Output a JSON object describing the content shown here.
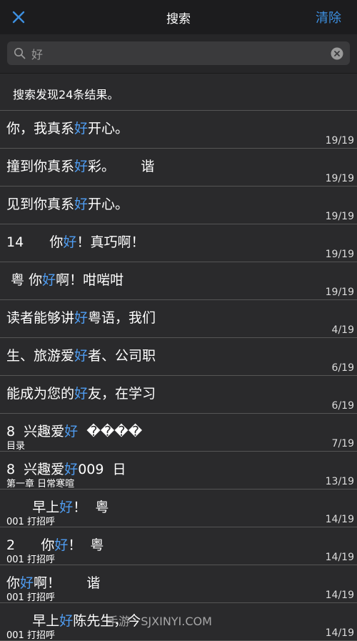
{
  "nav": {
    "title": "搜索",
    "clear_label": "清除",
    "close_icon": "close-icon"
  },
  "search": {
    "value": "好",
    "placeholder": ""
  },
  "summary": "搜索发现24条结果。",
  "results": [
    {
      "pre": "你，我真系",
      "hl": "好",
      "post": "开心。",
      "sub": "",
      "page": "19/19"
    },
    {
      "pre": "撞到你真系",
      "hl": "好",
      "post": "彩。      谐",
      "sub": "",
      "page": "19/19"
    },
    {
      "pre": "见到你真系",
      "hl": "好",
      "post": "开心。",
      "sub": "",
      "page": "19/19"
    },
    {
      "pre": "14      你",
      "hl": "好",
      "post": "！真巧啊！",
      "sub": "",
      "page": "19/19"
    },
    {
      "pre": " 粤 你",
      "hl": "好",
      "post": "啊！咁啱咁",
      "sub": "",
      "page": "19/19"
    },
    {
      "pre": "读者能够讲",
      "hl": "好",
      "post": "粤语，我们",
      "sub": "",
      "page": "4/19"
    },
    {
      "pre": "生、旅游爱",
      "hl": "好",
      "post": "者、公司职",
      "sub": "",
      "page": "6/19"
    },
    {
      "pre": "能成为您的",
      "hl": "好",
      "post": "友，在学习",
      "sub": "",
      "page": "6/19"
    },
    {
      "pre": "8  兴趣爱",
      "hl": "好",
      "post": "  ����",
      "sub": "目录",
      "page": "7/19"
    },
    {
      "pre": "8  兴趣爱",
      "hl": "好",
      "post": "009  日",
      "sub": "第一章 日常寒暄",
      "page": "13/19"
    },
    {
      "pre": "      早上",
      "hl": "好",
      "post": "！  粤",
      "sub": "001 打招呼",
      "page": "14/19"
    },
    {
      "pre": "2      你",
      "hl": "好",
      "post": "！  粤",
      "sub": "001 打招呼",
      "page": "14/19"
    },
    {
      "pre": "你",
      "hl": "好",
      "post": "啊！      谐",
      "sub": "001 打招呼",
      "page": "14/19"
    },
    {
      "pre": "      早上",
      "hl": "好",
      "post": "陈先生，今",
      "sub": "001 打招呼",
      "page": "14/19"
    }
  ],
  "watermark": "手游   SJXINYI.COM"
}
